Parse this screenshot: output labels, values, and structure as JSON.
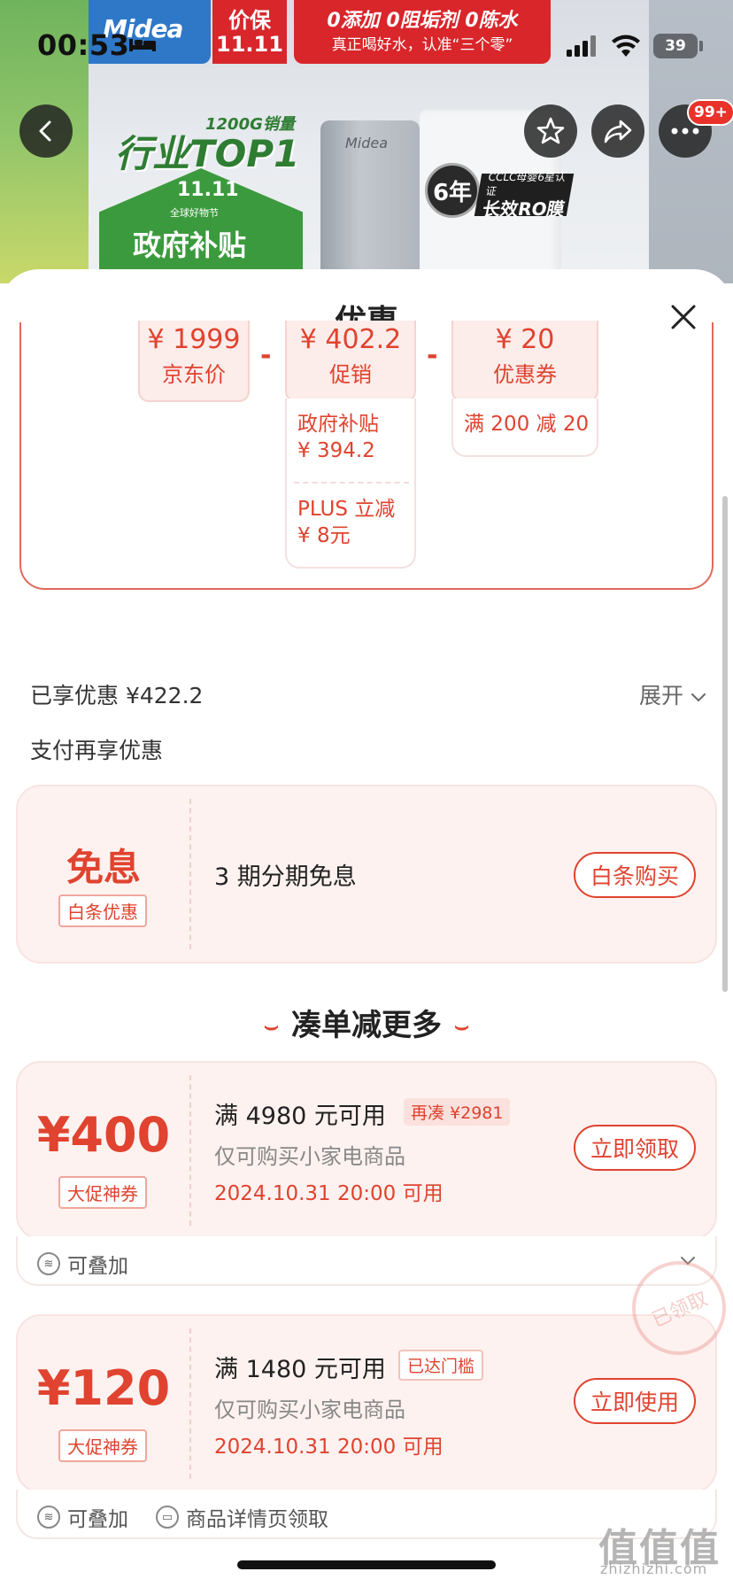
{
  "status_bar": {
    "time": "00:53",
    "battery": "39"
  },
  "hero": {
    "brand": "Midea",
    "tag_line1": "价保",
    "tag_line2": "11.11",
    "slogan_line1": "0添加 0阻垢剂 0陈水",
    "slogan_line2": "真正喝好水，认准“三个零”",
    "sales": "1200G销量",
    "top_badge": "行业TOP1",
    "event": "11.11",
    "event_sub": "全球好物节",
    "subsidy": "政府补贴",
    "purifier_logo": "Midea",
    "cert_years": "6年",
    "cert_line1": "CCLC母婴6星认证",
    "cert_line2": "长效RO膜"
  },
  "nav": {
    "badge": "99+"
  },
  "sheet": {
    "title": "优惠",
    "breakdown": {
      "jd": {
        "amount": "¥ 1999",
        "label": "京东价"
      },
      "promo": {
        "amount": "¥ 402.2",
        "label": "促销"
      },
      "coupon": {
        "amount": "¥ 20",
        "label": "优惠券"
      },
      "promo_items": [
        {
          "line1": "政府补贴",
          "line2": "¥ 394.2"
        },
        {
          "line1": "PLUS 立减",
          "line2": "¥ 8元"
        }
      ],
      "coupon_item": "满 200 减 20",
      "minus": "-"
    },
    "enjoyed": "已享优惠 ¥422.2",
    "expand": "展开",
    "pay_more": "支付再享优惠",
    "interest_card": {
      "big": "免息",
      "tag": "白条优惠",
      "text": "3 期分期免息",
      "button": "白条购买"
    },
    "section_title": "凑单减更多",
    "coupons": [
      {
        "amount": "¥400",
        "tag": "大促神券",
        "condition": "满 4980 元可用",
        "badge": "再凑 ¥2981",
        "scope": "仅可购买小家电商品",
        "date": "2024.10.31 20:00 可用",
        "button": "立即领取",
        "foot": [
          "可叠加"
        ]
      },
      {
        "amount": "¥120",
        "tag": "大促神券",
        "condition": "满 1480 元可用",
        "badge": "已达门槛",
        "scope": "仅可购买小家电商品",
        "date": "2024.10.31 20:00 可用",
        "button": "立即使用",
        "foot": [
          "可叠加",
          "商品详情页领取"
        ],
        "stamp": "已领取"
      }
    ]
  },
  "watermark": {
    "main": "值值值",
    "sub": "zhizhizhi.com"
  },
  "colors": {
    "accent": "#e0432f",
    "card_bg": "#fdf2f0",
    "border": "#e06a5a"
  }
}
